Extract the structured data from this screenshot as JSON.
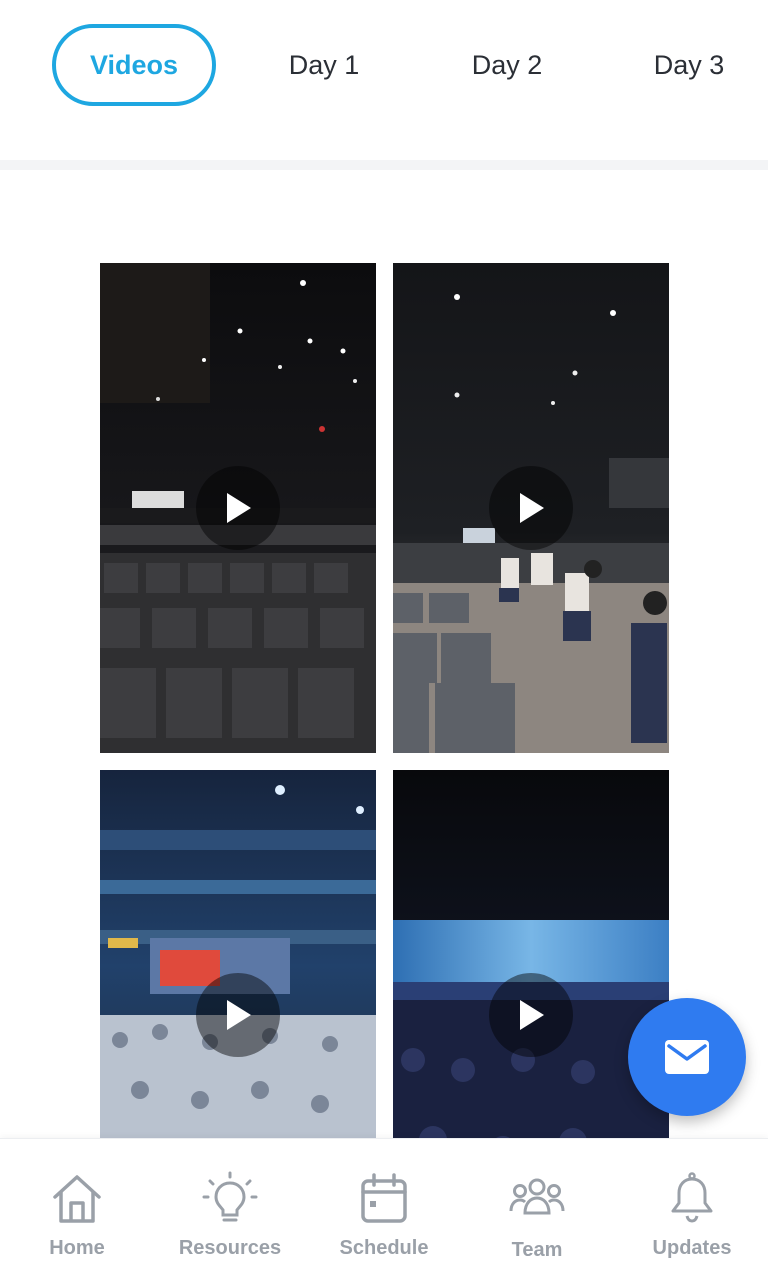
{
  "tabs": [
    {
      "label": "Videos",
      "active": true
    },
    {
      "label": "Day 1",
      "active": false
    },
    {
      "label": "Day 2",
      "active": false
    },
    {
      "label": "Day 3",
      "active": false
    }
  ],
  "videos": [
    {
      "scene": "empty auditorium seats"
    },
    {
      "scene": "people running between seats"
    },
    {
      "scene": "crowd with stage screens"
    },
    {
      "scene": "dark arena with banner screen"
    }
  ],
  "fab": {
    "icon": "mail-icon"
  },
  "bottom_nav": [
    {
      "label": "Home",
      "icon": "home-icon"
    },
    {
      "label": "Resources",
      "icon": "lightbulb-icon"
    },
    {
      "label": "Schedule",
      "icon": "calendar-icon"
    },
    {
      "label": "Team",
      "icon": "team-icon"
    },
    {
      "label": "Updates",
      "icon": "bell-icon"
    }
  ],
  "colors": {
    "accent": "#1ea7e1",
    "fab": "#2f7bf0",
    "nav_inactive": "#9aa0a8"
  }
}
